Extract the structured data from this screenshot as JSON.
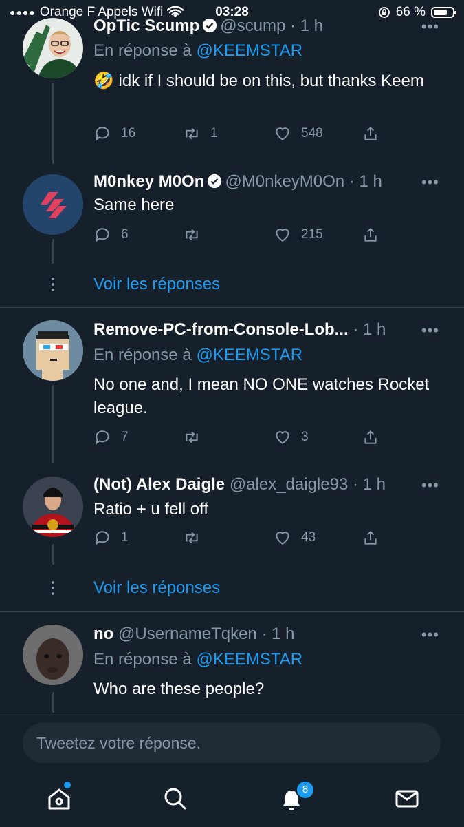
{
  "status_bar": {
    "carrier": "Orange F Appels Wifi",
    "time": "03:28",
    "battery": "66 %"
  },
  "tweets": [
    {
      "name": "OpTic Scump",
      "handle": "@scump",
      "time": "· 1 h",
      "reply_prefix": "En réponse à",
      "reply_to": "@KEEMSTAR",
      "text": "🤣 idk if I should be on this, but thanks Keem",
      "replies": "16",
      "retweets": "1",
      "likes": "548"
    },
    {
      "name": "M0nkey M0On",
      "handle": "@M0nkeyM0On",
      "time": "· 1 h",
      "text": "Same here",
      "replies": "6",
      "retweets": "",
      "likes": "215"
    },
    {
      "name": "Remove-PC-from-Console-Lob...",
      "handle": "",
      "time": "· 1 h",
      "reply_prefix": "En réponse à",
      "reply_to": "@KEEMSTAR",
      "text": "No one and, I mean NO ONE watches Rocket league.",
      "replies": "7",
      "retweets": "",
      "likes": "3"
    },
    {
      "name": "(Not) Alex Daigle",
      "handle": "@alex_daigle93",
      "time": "· 1 h",
      "text": "Ratio + u fell off",
      "replies": "1",
      "retweets": "",
      "likes": "43"
    },
    {
      "name": "no",
      "handle": "@UsernameTqken",
      "time": "· 1 h",
      "reply_prefix": "En réponse à",
      "reply_to": "@KEEMSTAR",
      "text": "Who are these people?"
    }
  ],
  "voir_reponses": "Voir les réponses",
  "compose": {
    "placeholder": "Tweetez votre réponse."
  },
  "tabbar": {
    "items": [
      "home-icon",
      "search-icon",
      "notifications-icon",
      "messages-icon"
    ],
    "notifications_badge": "8"
  },
  "colors": {
    "background": "#15202b",
    "accent": "#1d9bf0",
    "muted": "#8899a6",
    "divider": "#38444d"
  },
  "more_glyph": "•••"
}
